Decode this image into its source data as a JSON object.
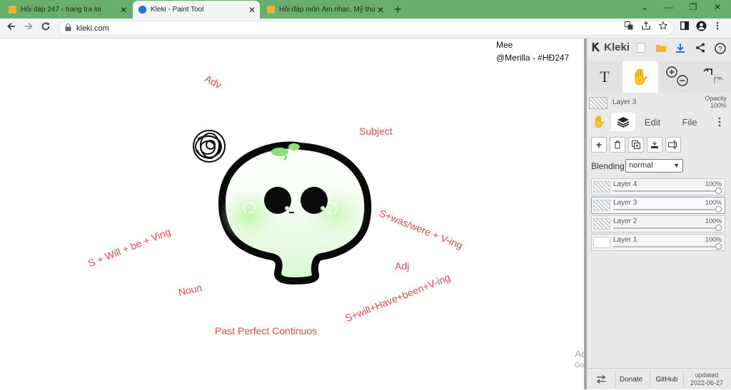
{
  "browser": {
    "tabs": [
      {
        "title": "Hỏi đáp 247 - trang tra loi",
        "active": false,
        "favicon_color": "#e2b53a"
      },
      {
        "title": "Kleki - Paint Tool",
        "active": true,
        "favicon_color": "#2a6bd6"
      },
      {
        "title": "Hỏi đáp môn Âm nhạc, Mỹ thuật",
        "active": false,
        "favicon_color": "#e2b53a"
      }
    ],
    "close_glyph": "✕",
    "new_tab_glyph": "+",
    "url": "kleki.com",
    "icons": [
      "back-arrow-icon",
      "forward-arrow-icon",
      "reload-icon",
      "lock-icon",
      "translate-icon",
      "share-icon",
      "star-icon",
      "sidebar-icon",
      "profile-icon",
      "menu-icon"
    ],
    "window_controls": {
      "chevron": "⌄",
      "minimize": "—",
      "restore": "❐",
      "close": "✕"
    }
  },
  "canvas": {
    "labels": [
      {
        "text": "Adv"
      },
      {
        "text": "Subject"
      },
      {
        "text": "S+was/were + V-ing"
      },
      {
        "text": "S + Will + be + Ving"
      },
      {
        "text": "Adj"
      },
      {
        "text": "Noun"
      },
      {
        "text": "S+will+Have+been+V-ing"
      },
      {
        "text": "Past Perfect Continuos"
      }
    ],
    "signature": [
      "Mee",
      "@Merilla - #HĐ247"
    ],
    "label_color": "#e8484e",
    "watermark": {
      "title": "Activate Windows",
      "subtitle": "Go to Settings to activate Windows."
    }
  },
  "panel": {
    "logo": "Kleki",
    "top_icons": [
      "new-image-icon",
      "open-folder-icon",
      "download-icon",
      "share-icon",
      "help-icon"
    ],
    "tools": {
      "text_glyph": "T",
      "hand_glyph": "✋"
    },
    "current_layer": "Layer 3",
    "opacity_label": "Opacity",
    "opacity_value": "100%",
    "tabs": [
      "Edit",
      "File"
    ],
    "blending_label": "Blending",
    "blending_value": "normal",
    "layers": [
      {
        "name": "Layer 4",
        "opacity": "100%",
        "selected": false
      },
      {
        "name": "Layer 3",
        "opacity": "100%",
        "selected": true
      },
      {
        "name": "Layer 2",
        "opacity": "100%",
        "selected": false
      },
      {
        "name": "Layer 1",
        "opacity": "100%",
        "selected": false
      }
    ],
    "footer": {
      "donate": "Donate",
      "github": "GitHub",
      "updated_label": "updated",
      "updated_date": "2022-06-27"
    }
  }
}
